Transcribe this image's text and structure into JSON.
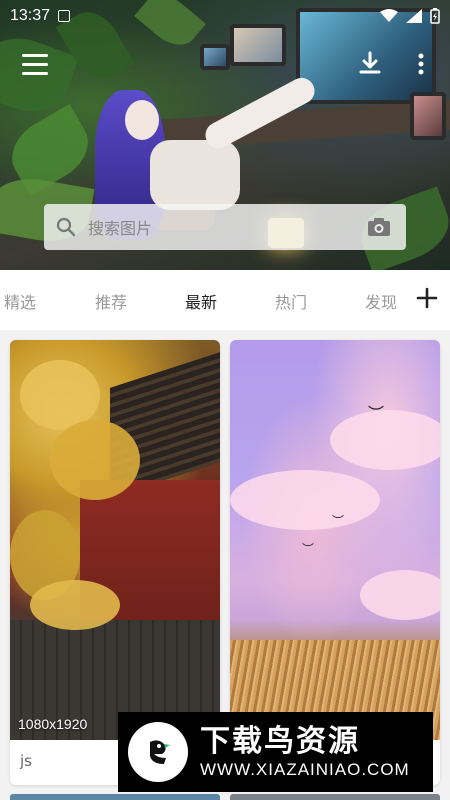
{
  "status_bar": {
    "time": "13:37",
    "notification_icon": "sim-notification-icon"
  },
  "header": {
    "menu_icon": "menu-icon",
    "download_icon": "download-icon",
    "more_icon": "more-vertical-icon"
  },
  "search": {
    "placeholder": "搜索图片",
    "search_icon": "search-icon",
    "camera_icon": "camera-icon"
  },
  "tabs": [
    {
      "label": "精选",
      "active": false
    },
    {
      "label": "推荐",
      "active": false
    },
    {
      "label": "最新",
      "active": true
    },
    {
      "label": "热门",
      "active": false
    },
    {
      "label": "发现",
      "active": false
    }
  ],
  "add_tab_icon": "plus-icon",
  "cards": [
    {
      "resolution": "1080x1920",
      "author": "js"
    },
    {
      "resolution": "",
      "author": ""
    }
  ],
  "watermark": {
    "title": "下载鸟资源",
    "url": "WWW.XIAZAINIAO.COM"
  },
  "colors": {
    "active_tab": "#222222",
    "inactive_tab": "#999999",
    "background": "#f2f2f2"
  }
}
